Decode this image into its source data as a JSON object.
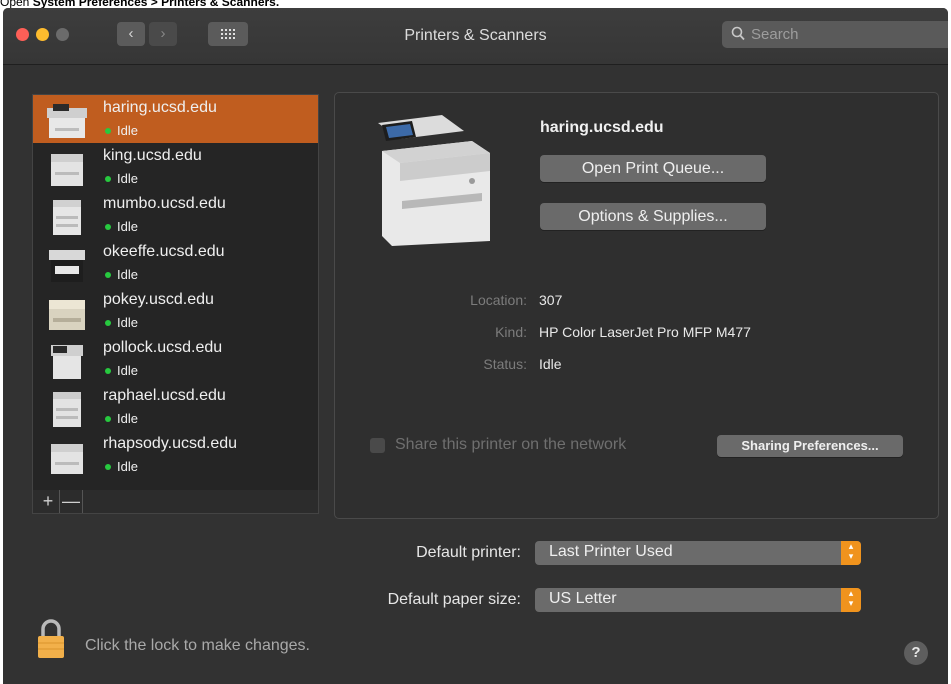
{
  "caption": {
    "prefix": "Open ",
    "bold": "System Preferences > Printers & Scanners."
  },
  "window": {
    "title": "Printers & Scanners"
  },
  "search": {
    "placeholder": "Search"
  },
  "printers": [
    {
      "name": "haring.ucsd.edu",
      "status": "Idle",
      "selected": true
    },
    {
      "name": "king.ucsd.edu",
      "status": "Idle"
    },
    {
      "name": "mumbo.ucsd.edu",
      "status": "Idle"
    },
    {
      "name": "okeeffe.ucsd.edu",
      "status": "Idle"
    },
    {
      "name": "pokey.uscd.edu",
      "status": "Idle"
    },
    {
      "name": "pollock.ucsd.edu",
      "status": "Idle"
    },
    {
      "name": "raphael.ucsd.edu",
      "status": "Idle"
    },
    {
      "name": "rhapsody.ucsd.edu",
      "status": "Idle"
    }
  ],
  "list_controls": {
    "add": "+",
    "remove": "—"
  },
  "detail": {
    "name": "haring.ucsd.edu",
    "open_queue": "Open Print Queue...",
    "options": "Options & Supplies...",
    "location_label": "Location:",
    "location": "307",
    "kind_label": "Kind:",
    "kind": "HP Color LaserJet Pro MFP M477",
    "status_label": "Status:",
    "status": "Idle",
    "share_label": "Share this printer on the network",
    "sharing_prefs": "Sharing Preferences..."
  },
  "defaults": {
    "printer_label": "Default printer:",
    "printer_value": "Last Printer Used",
    "paper_label": "Default paper size:",
    "paper_value": "US Letter"
  },
  "footer": {
    "lock_text": "Click the lock to make changes.",
    "help": "?"
  },
  "colors": {
    "selection": "#c05d1f",
    "accent": "#f0931d",
    "status_dot": "#27c93f"
  }
}
